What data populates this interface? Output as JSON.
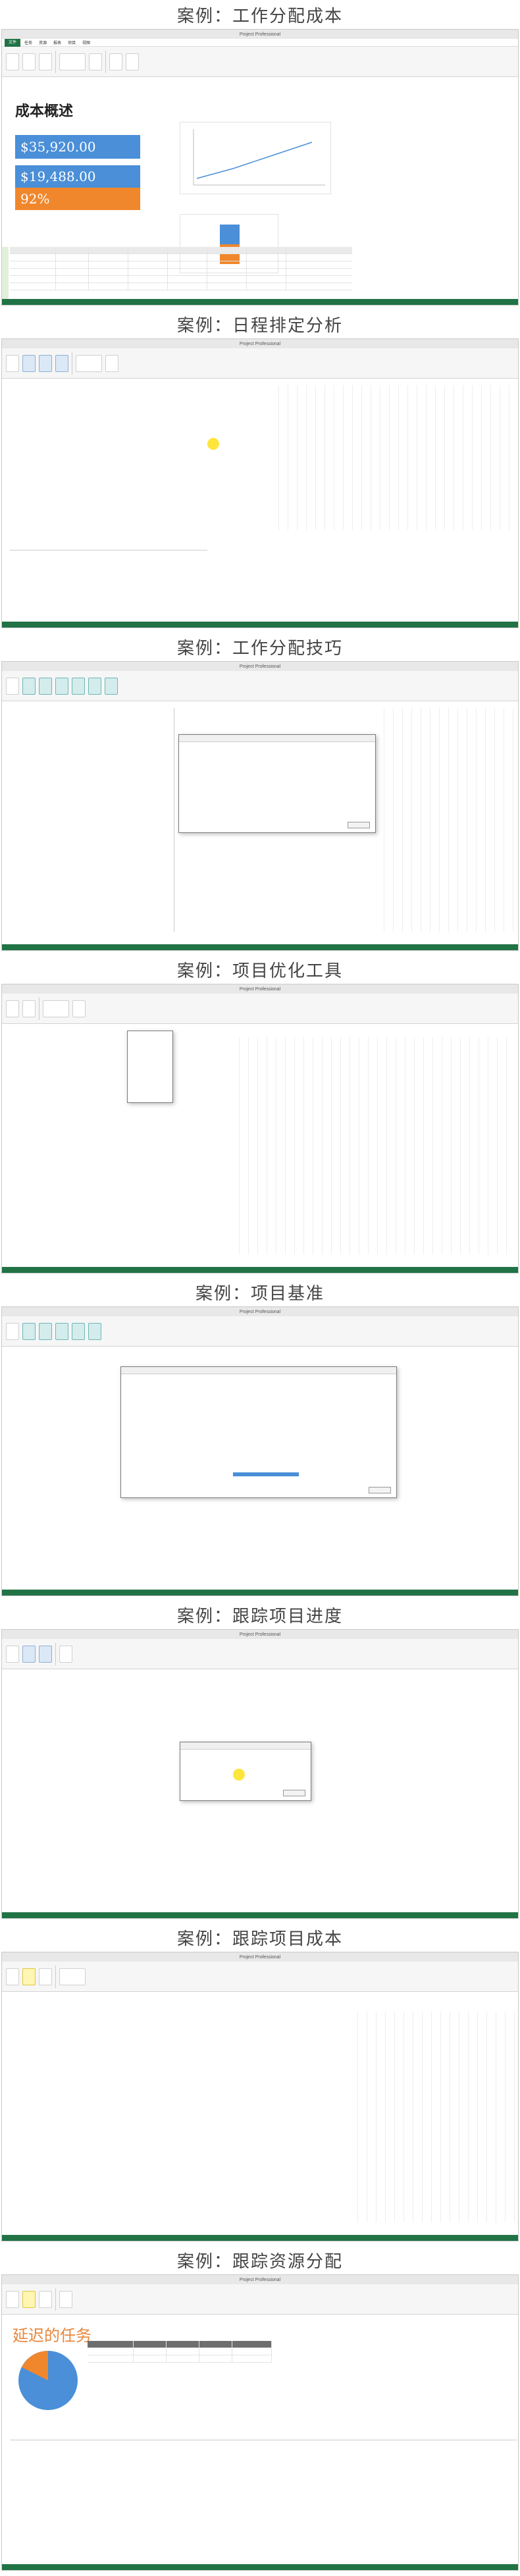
{
  "sections": [
    {
      "title": "案例：工作分配成本",
      "app_title": "Project Professional",
      "report": {
        "heading": "成本概述",
        "kpi_cost": "$35,920.00",
        "kpi_remaining": "$19,488.00",
        "kpi_percent": "92%"
      }
    },
    {
      "title": "案例：日程排定分析",
      "app_title": "Project Professional"
    },
    {
      "title": "案例：工作分配技巧",
      "app_title": "Project Professional"
    },
    {
      "title": "案例：项目优化工具",
      "app_title": "Project Professional"
    },
    {
      "title": "案例：项目基准",
      "app_title": "Project Professional"
    },
    {
      "title": "案例：跟踪项目进度",
      "app_title": "Project Professional"
    },
    {
      "title": "案例：跟踪项目成本",
      "app_title": "Project Professional"
    },
    {
      "title": "案例：跟踪资源分配",
      "app_title": "Project Professional",
      "report": {
        "heading": "延迟的任务"
      }
    }
  ],
  "menu": {
    "file": "文件",
    "tabs": [
      "任务",
      "资源",
      "报表",
      "项目",
      "视图",
      "格式"
    ]
  },
  "colors": {
    "excel_green": "#217346",
    "kpi_blue": "#4a8fd8",
    "kpi_orange": "#f0872d",
    "highlight": "#ffe11a"
  }
}
